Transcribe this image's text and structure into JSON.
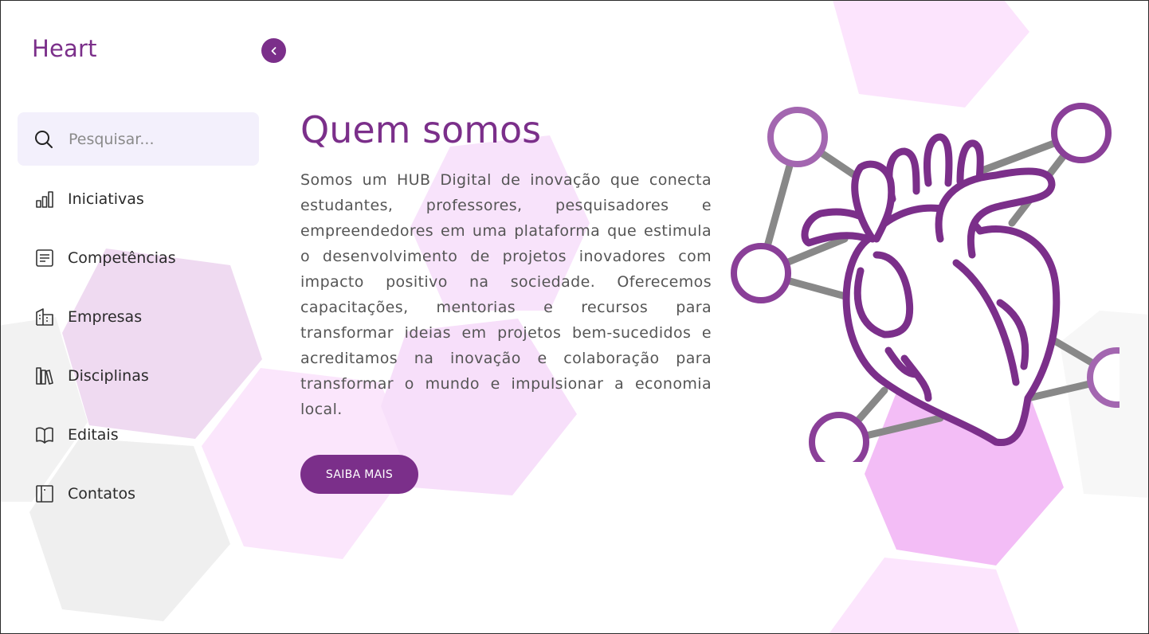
{
  "app": {
    "brand": "Heart"
  },
  "colors": {
    "primary": "#7b2f8a",
    "search_bg": "#f3f0fc"
  },
  "sidebar": {
    "collapse_icon": "chevron-left-icon",
    "search": {
      "placeholder": "Pesquisar...",
      "value": "",
      "icon": "search-icon"
    },
    "items": [
      {
        "label": "Iniciativas",
        "icon": "bar-chart-icon"
      },
      {
        "label": "Competências",
        "icon": "document-icon"
      },
      {
        "label": "Empresas",
        "icon": "building-icon"
      },
      {
        "label": "Disciplinas",
        "icon": "books-icon"
      },
      {
        "label": "Editais",
        "icon": "open-book-icon"
      },
      {
        "label": "Contatos",
        "icon": "contact-book-icon"
      }
    ]
  },
  "main": {
    "title": "Quem somos",
    "description": "Somos um HUB Digital de inovação que conecta estudantes, professores, pesquisadores e empreendedores em uma plataforma que estimula o desenvolvimento de projetos inovadores com impacto positivo na sociedade. Oferecemos capacitações, mentorias e recursos para transformar ideias em projetos bem-sucedidos e acreditamos na inovação e colaboração para transformar o mundo e impulsionar a economia local.",
    "cta_label": "SAIBA MAIS",
    "illustration_icon": "anatomical-heart-network-icon"
  }
}
